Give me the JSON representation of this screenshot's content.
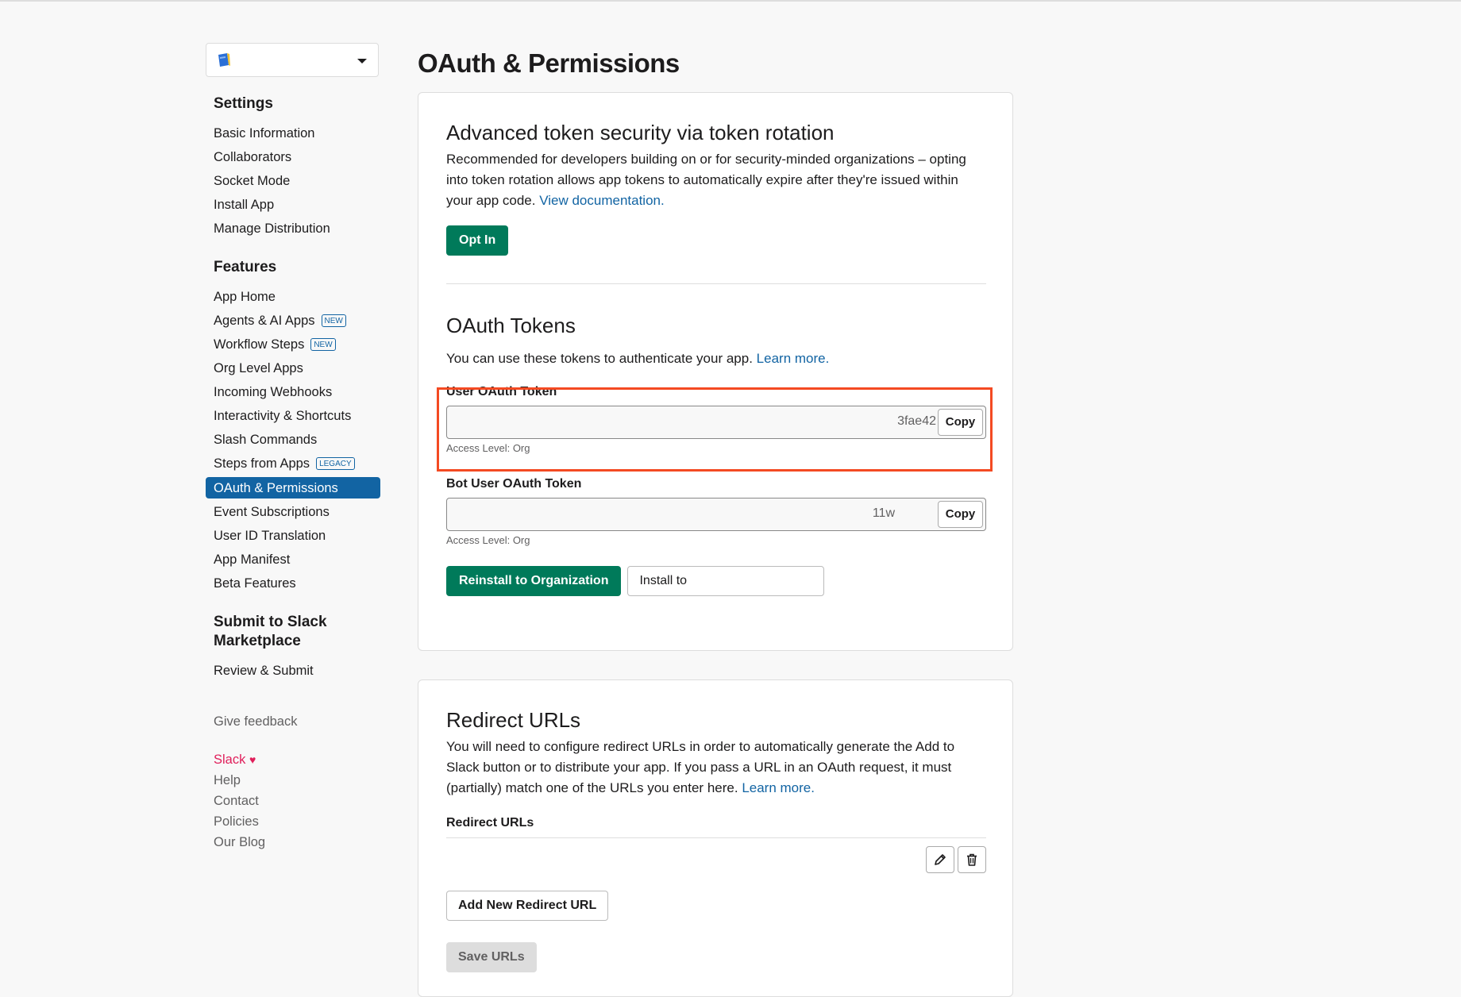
{
  "sidebar": {
    "app_selector": {
      "icon": "app-book-icon",
      "value": ""
    },
    "sections": [
      {
        "title": "Settings",
        "items": [
          {
            "label": "Basic Information"
          },
          {
            "label": "Collaborators"
          },
          {
            "label": "Socket Mode"
          },
          {
            "label": "Install App"
          },
          {
            "label": "Manage Distribution"
          }
        ]
      },
      {
        "title": "Features",
        "items": [
          {
            "label": "App Home"
          },
          {
            "label": "Agents & AI Apps",
            "badge": "NEW"
          },
          {
            "label": "Workflow Steps",
            "badge": "NEW"
          },
          {
            "label": "Org Level Apps"
          },
          {
            "label": "Incoming Webhooks"
          },
          {
            "label": "Interactivity & Shortcuts"
          },
          {
            "label": "Slash Commands"
          },
          {
            "label": "Steps from Apps",
            "badge": "LEGACY"
          },
          {
            "label": "OAuth & Permissions",
            "active": true
          },
          {
            "label": "Event Subscriptions"
          },
          {
            "label": "User ID Translation"
          },
          {
            "label": "App Manifest"
          },
          {
            "label": "Beta Features"
          }
        ]
      },
      {
        "title": "Submit to Slack Marketplace",
        "items": [
          {
            "label": "Review & Submit"
          }
        ]
      }
    ],
    "feedback": "Give feedback",
    "footer": {
      "slack": "Slack",
      "heart": "♥",
      "links": [
        "Help",
        "Contact",
        "Policies",
        "Our Blog"
      ]
    }
  },
  "main": {
    "title": "OAuth & Permissions",
    "token_rotation": {
      "heading": "Advanced token security via token rotation",
      "body": "Recommended for developers building on or for security-minded organizations – opting into token rotation allows app tokens to automatically expire after they're issued within your app code.",
      "link": "View documentation.",
      "button": "Opt In"
    },
    "oauth_tokens": {
      "heading": "OAuth Tokens",
      "body": "You can use these tokens to authenticate your app.",
      "link": "Learn more.",
      "user_token": {
        "label": "User OAuth Token",
        "value_tail": "3fae42",
        "copy": "Copy",
        "access": "Access Level: Org"
      },
      "bot_token": {
        "label": "Bot User OAuth Token",
        "value_tail": "11w",
        "copy": "Copy",
        "access": "Access Level: Org"
      },
      "reinstall_button": "Reinstall to Organization",
      "install_to_button": "Install to"
    },
    "redirect": {
      "heading": "Redirect URLs",
      "body": "You will need to configure redirect URLs in order to automatically generate the Add to Slack button or to distribute your app. If you pass a URL in an OAuth request, it must (partially) match one of the URLs you enter here.",
      "link": "Learn more.",
      "list_label": "Redirect URLs",
      "add_button": "Add New Redirect URL",
      "save_button": "Save URLs"
    }
  },
  "colors": {
    "accent": "#1264a3",
    "primary_button": "#007a5a",
    "highlight": "#f44a22"
  }
}
